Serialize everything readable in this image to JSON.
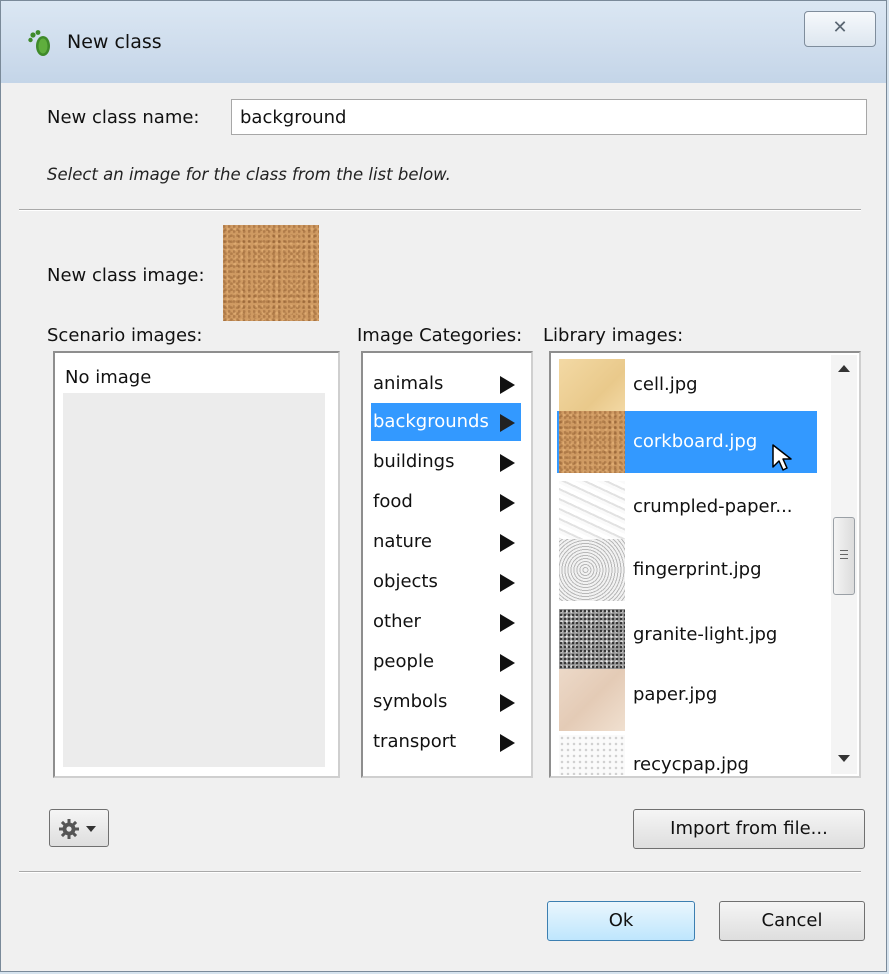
{
  "window": {
    "title": "New class",
    "close_glyph": "✕",
    "title_icon": "greenfoot-footprint-icon"
  },
  "form": {
    "name_label": "New class name:",
    "name_value": "background",
    "hint": "Select an image for the class from the list below.",
    "image_label": "New class image:"
  },
  "scenario": {
    "label": "Scenario images:",
    "items": [
      "No image"
    ]
  },
  "categories": {
    "label": "Image Categories:",
    "selected": "backgrounds",
    "items": [
      "animals",
      "backgrounds",
      "buildings",
      "food",
      "nature",
      "objects",
      "other",
      "people",
      "symbols",
      "transport"
    ]
  },
  "library": {
    "label": "Library images:",
    "selected": "corkboard.jpg",
    "items": [
      "cell.jpg",
      "corkboard.jpg",
      "crumpled-paper...",
      "fingerprint.jpg",
      "granite-light.jpg",
      "paper.jpg",
      "recycpap.jpg"
    ]
  },
  "buttons": {
    "gear_icon": "gear-icon",
    "import": "Import from file...",
    "ok": "Ok",
    "cancel": "Cancel"
  },
  "colors": {
    "selection": "#3399ff",
    "ok_button": "#bee6fd"
  }
}
